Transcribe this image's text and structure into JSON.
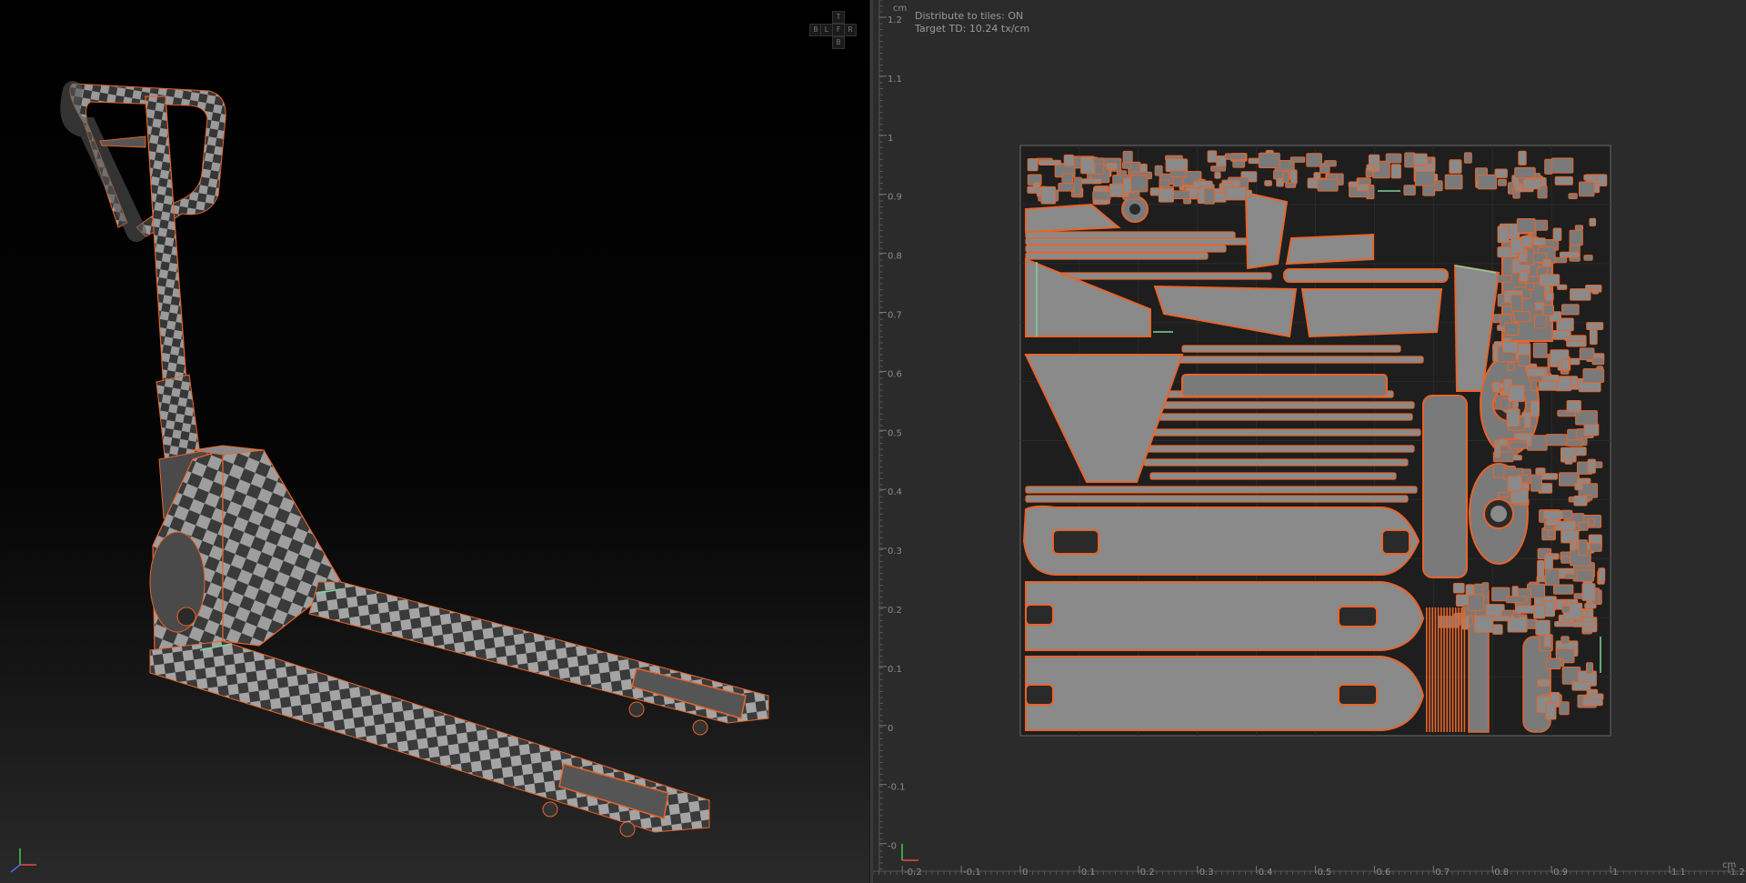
{
  "uv_overlay": {
    "distribute": "Distribute to tiles: ON",
    "target_td": "Target TD: 10.24 tx/cm"
  },
  "vertical_ruler": {
    "unit": "cm",
    "labels": [
      "1.2",
      "1.1",
      "1",
      "0.9",
      "0.8",
      "0.7",
      "0.6",
      "0.5",
      "0.4",
      "0.3",
      "0.2",
      "0.1",
      "0",
      "-0.1",
      "-0"
    ]
  },
  "horizontal_ruler": {
    "unit": "cm",
    "labels": [
      "-0.2",
      "-0.1",
      "0",
      "0.1",
      "0.2",
      "0.3",
      "0.4",
      "0.5",
      "0.6",
      "0.7",
      "0.8",
      "0.9",
      "1",
      "1.1",
      "1.2"
    ]
  },
  "view_cube": {
    "top": "T",
    "left": "L",
    "back_left": "B",
    "front": "F",
    "right": "R",
    "bottom": "B"
  },
  "colors": {
    "accent_edges": "#e8642a",
    "seam": "#7fd39a",
    "checker_light": "#9e9e9e",
    "checker_dark": "#3a3a3a",
    "uv_fill": "#8a8a8a"
  }
}
